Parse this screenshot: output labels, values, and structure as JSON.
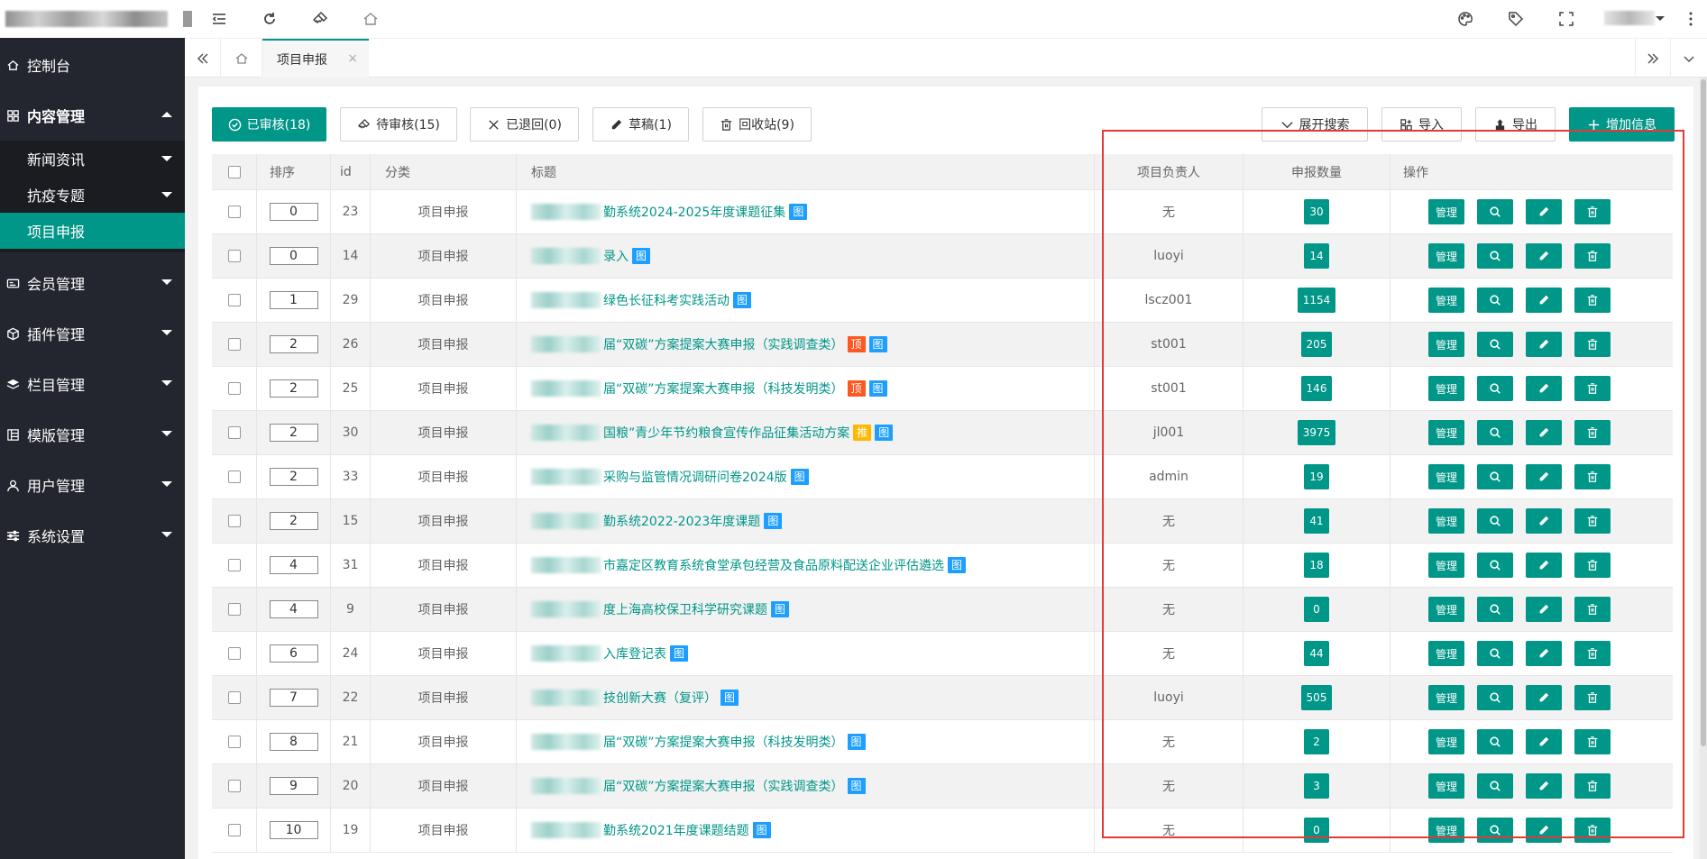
{
  "sidebar": {
    "items": [
      {
        "label": "控制台",
        "icon": "home-icon"
      },
      {
        "label": "内容管理",
        "icon": "grid-icon"
      },
      {
        "label": "会员管理",
        "icon": "card-icon"
      },
      {
        "label": "插件管理",
        "icon": "cube-icon"
      },
      {
        "label": "栏目管理",
        "icon": "layers-icon"
      },
      {
        "label": "模版管理",
        "icon": "template-icon"
      },
      {
        "label": "用户管理",
        "icon": "user-icon"
      },
      {
        "label": "系统设置",
        "icon": "sliders-icon"
      }
    ],
    "sub_items": [
      {
        "label": "新闻资讯"
      },
      {
        "label": "抗疫专题"
      },
      {
        "label": "项目申报"
      }
    ]
  },
  "tabs": {
    "active_label": "项目申报",
    "close": "×"
  },
  "toolbar": {
    "approved": "已审核(18)",
    "pending": "待审核(15)",
    "returned": "已退回(0)",
    "draft": "草稿(1)",
    "recycle": "回收站(9)",
    "expand_search": "展开搜索",
    "import": "导入",
    "export": "导出",
    "add": "增加信息"
  },
  "table": {
    "headers": {
      "sort": "排序",
      "id": "id",
      "category": "分类",
      "title": "标题",
      "owner": "项目负责人",
      "count": "申报数量",
      "ops": "操作"
    },
    "op_manage": "管理",
    "rows": [
      {
        "sort": "0",
        "id": "23",
        "category": "项目申报",
        "title": "勤系统2024-2025年度课题征集",
        "tags": [
          "图"
        ],
        "owner": "无",
        "count": "30"
      },
      {
        "sort": "0",
        "id": "14",
        "category": "项目申报",
        "title": "录入",
        "tags": [
          "图"
        ],
        "owner": "luoyi",
        "count": "14"
      },
      {
        "sort": "1",
        "id": "29",
        "category": "项目申报",
        "title": "绿色长征科考实践活动",
        "tags": [
          "图"
        ],
        "owner": "lscz001",
        "count": "1154"
      },
      {
        "sort": "2",
        "id": "26",
        "category": "项目申报",
        "title": "届“双碳”方案提案大赛申报（实践调查类）",
        "tags": [
          "顶",
          "图"
        ],
        "owner": "st001",
        "count": "205"
      },
      {
        "sort": "2",
        "id": "25",
        "category": "项目申报",
        "title": "届“双碳”方案提案大赛申报（科技发明类）",
        "tags": [
          "顶",
          "图"
        ],
        "owner": "st001",
        "count": "146"
      },
      {
        "sort": "2",
        "id": "30",
        "category": "项目申报",
        "title": "国粮”青少年节约粮食宣传作品征集活动方案",
        "tags": [
          "推",
          "图"
        ],
        "owner": "jl001",
        "count": "3975"
      },
      {
        "sort": "2",
        "id": "33",
        "category": "项目申报",
        "title": "采购与监管情况调研问卷2024版",
        "tags": [
          "图"
        ],
        "owner": "admin",
        "count": "19"
      },
      {
        "sort": "2",
        "id": "15",
        "category": "项目申报",
        "title": "勤系统2022-2023年度课题",
        "tags": [
          "图"
        ],
        "owner": "无",
        "count": "41"
      },
      {
        "sort": "4",
        "id": "31",
        "category": "项目申报",
        "title": "市嘉定区教育系统食堂承包经营及食品原料配送企业评估遴选",
        "tags": [
          "图"
        ],
        "owner": "无",
        "count": "18"
      },
      {
        "sort": "4",
        "id": "9",
        "category": "项目申报",
        "title": "度上海高校保卫科学研究课题",
        "tags": [
          "图"
        ],
        "owner": "无",
        "count": "0"
      },
      {
        "sort": "6",
        "id": "24",
        "category": "项目申报",
        "title": "入库登记表",
        "tags": [
          "图"
        ],
        "owner": "无",
        "count": "44"
      },
      {
        "sort": "7",
        "id": "22",
        "category": "项目申报",
        "title": "技创新大赛（复评）",
        "tags": [
          "图"
        ],
        "owner": "luoyi",
        "count": "505"
      },
      {
        "sort": "8",
        "id": "21",
        "category": "项目申报",
        "title": "届“双碳”方案提案大赛申报（科技发明类）",
        "tags": [
          "图"
        ],
        "owner": "无",
        "count": "2"
      },
      {
        "sort": "9",
        "id": "20",
        "category": "项目申报",
        "title": "届“双碳”方案提案大赛申报（实践调查类）",
        "tags": [
          "图"
        ],
        "owner": "无",
        "count": "3"
      },
      {
        "sort": "10",
        "id": "19",
        "category": "项目申报",
        "title": "勤系统2021年度课题结题",
        "tags": [
          "图"
        ],
        "owner": "无",
        "count": "0"
      }
    ]
  },
  "colors": {
    "primary": "#009688",
    "sidebar": "#23262e",
    "tag_blue": "#1e9fff",
    "tag_top": "#ff5722",
    "tag_rec": "#ffb800",
    "highlight": "#e53935"
  }
}
